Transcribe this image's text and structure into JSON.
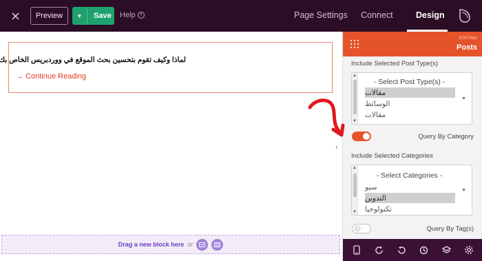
{
  "topbar": {
    "preview_label": "Preview",
    "save_label": "Save",
    "help_label": "Help",
    "tabs": [
      {
        "label": "Page Settings",
        "active": false
      },
      {
        "label": "Connect",
        "active": false
      },
      {
        "label": "Design",
        "active": true
      }
    ],
    "colors": {
      "bar": "#2b0d25",
      "save": "#1fa16d"
    }
  },
  "canvas": {
    "post_title": "لماذا وكيف تقوم بتحسين بحث الموقع في ووردبريس الخاص بك",
    "continue_link": "→ Continue Reading",
    "dropzone_text": "Drag a new block here",
    "dropzone_or": "or"
  },
  "panel": {
    "editing_label": "EDITING",
    "editing_target": "Posts",
    "accent": "#e5532b",
    "post_types": {
      "label": "Include Selected Post Type(s)",
      "options": [
        {
          "label": "- Select Post Type(s) -",
          "selected": false
        },
        {
          "label": "مقالات",
          "selected": true
        },
        {
          "label": "الوسائط",
          "selected": false
        },
        {
          "label": "مقالات",
          "selected": false
        }
      ]
    },
    "query_by_category": {
      "label": "Query By Category",
      "enabled": true
    },
    "categories": {
      "label": "Include Selected Categories",
      "options": [
        {
          "label": "- Select Categories -",
          "selected": false
        },
        {
          "label": "سيو",
          "selected": false
        },
        {
          "label": "التدوين",
          "selected": true
        },
        {
          "label": "تكنولوجيا",
          "selected": false
        }
      ]
    },
    "query_by_tags": {
      "label": "Query By Tag(s)",
      "enabled": false
    },
    "footer_icons": [
      "mobile-icon",
      "refresh-icon",
      "undo-icon",
      "history-icon",
      "layers-icon",
      "settings-icon"
    ]
  }
}
